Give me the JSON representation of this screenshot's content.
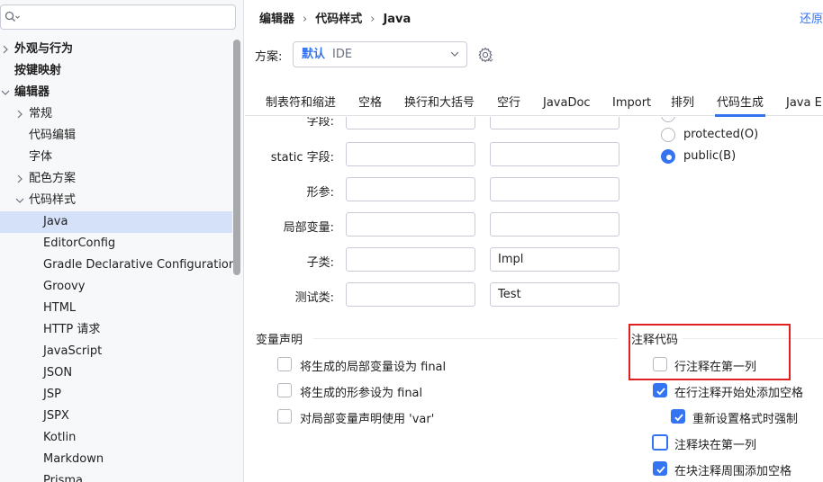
{
  "sidebar": {
    "search": {
      "value": "",
      "placeholder": ""
    },
    "items": [
      {
        "label": "外观与行为"
      },
      {
        "label": "按键映射"
      },
      {
        "label": "编辑器"
      },
      {
        "label": "常规"
      },
      {
        "label": "代码编辑"
      },
      {
        "label": "字体"
      },
      {
        "label": "配色方案"
      },
      {
        "label": "代码样式"
      },
      {
        "label": "Java"
      },
      {
        "label": "EditorConfig"
      },
      {
        "label": "Gradle Declarative Configuration"
      },
      {
        "label": "Groovy"
      },
      {
        "label": "HTML"
      },
      {
        "label": "HTTP 请求"
      },
      {
        "label": "JavaScript"
      },
      {
        "label": "JSON"
      },
      {
        "label": "JSP"
      },
      {
        "label": "JSPX"
      },
      {
        "label": "Kotlin"
      },
      {
        "label": "Markdown"
      },
      {
        "label": "Prisma"
      }
    ]
  },
  "breadcrumb": [
    "编辑器",
    "代码样式",
    "Java"
  ],
  "breadcrumb_separator": "›",
  "reset_label": "还原",
  "scheme": {
    "label": "方案:",
    "primary": "默认",
    "secondary": "IDE"
  },
  "tabs": [
    {
      "label": "制表符和缩进"
    },
    {
      "label": "空格"
    },
    {
      "label": "换行和大括号"
    },
    {
      "label": "空行"
    },
    {
      "label": "JavaDoc"
    },
    {
      "label": "Import"
    },
    {
      "label": "排列"
    },
    {
      "label": "代码生成",
      "active": true
    },
    {
      "label": "Java El"
    }
  ],
  "naming": {
    "rows": [
      {
        "label": "字段:",
        "prefix": "",
        "suffix": ""
      },
      {
        "label": "static 字段:",
        "prefix": "",
        "suffix": ""
      },
      {
        "label": "形参:",
        "prefix": "",
        "suffix": ""
      },
      {
        "label": "局部变量:",
        "prefix": "",
        "suffix": ""
      },
      {
        "label": "子类:",
        "prefix": "",
        "suffix": "Impl"
      },
      {
        "label": "测试类:",
        "prefix": "",
        "suffix": "Test"
      }
    ]
  },
  "visibility": {
    "options": [
      {
        "label": "protected(O)",
        "checked": false
      },
      {
        "label": "public(B)",
        "checked": true
      }
    ]
  },
  "variable_decl": {
    "title": "变量声明",
    "options": [
      {
        "label": "将生成的局部变量设为 final",
        "checked": false
      },
      {
        "label": "将生成的形参设为 final",
        "checked": false
      },
      {
        "label": "对局部变量声明使用 'var'",
        "checked": false
      }
    ]
  },
  "comment_code": {
    "title": "注释代码",
    "options": [
      {
        "label": "行注释在第一列",
        "checked": false
      },
      {
        "label": "在行注释开始处添加空格",
        "checked": true
      },
      {
        "label": "重新设置格式时强制",
        "checked": true
      },
      {
        "label": "注释块在第一列",
        "checked": false
      },
      {
        "label": "在块注释周围添加空格",
        "checked": true
      }
    ]
  },
  "colors": {
    "accent": "#3574f0",
    "highlight": "#e0201e",
    "selected_row": "#d5e1f9"
  }
}
